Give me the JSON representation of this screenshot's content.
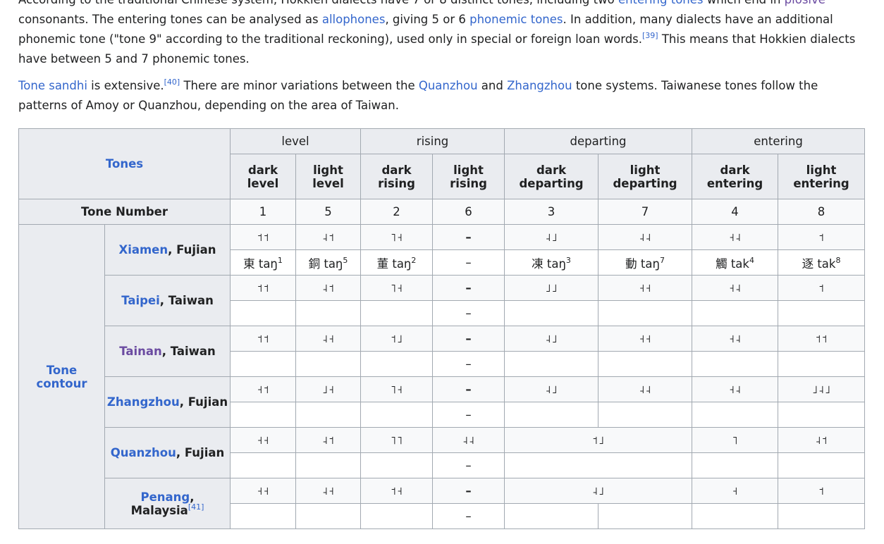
{
  "paragraph1": {
    "line0_pre": "According to the traditional Chinese system, Hokkien dialects have 7 or 8 distinct tones, including two ",
    "link_entering_tones": "entering tones",
    "line0_mid": " which end in ",
    "link_plosive": "plosive",
    "line0_post": " consonants. The entering tones can be analysed as ",
    "link_allophones": "allophones",
    "mid_text": ", giving 5 or 6 ",
    "link_phonemic_tones": "phonemic tones",
    "post_text": ". In addition, many dialects have an additional phonemic tone (\"tone 9\" according to the traditional reckoning), used only in special or foreign loan words.",
    "ref": "[39]",
    "tail_text": " This means that Hokkien dialects have between 5 and 7 phonemic tones."
  },
  "paragraph2": {
    "link_tone_sandhi": "Tone sandhi",
    "text1": " is extensive.",
    "ref": "[40]",
    "text2": " There are minor variations between the ",
    "link_quanzhou": "Quanzhou",
    "text3": " and ",
    "link_zhangzhou": "Zhangzhou",
    "text4": " tone systems. Taiwanese tones follow the patterns of Amoy or Quanzhou, depending on the area of Taiwan."
  },
  "table": {
    "corner_link": "Tones",
    "groups": [
      "level",
      "rising",
      "departing",
      "entering"
    ],
    "subheaders": [
      [
        "dark",
        "level"
      ],
      [
        "light",
        "level"
      ],
      [
        "dark",
        "rising"
      ],
      [
        "light",
        "rising"
      ],
      [
        "dark",
        "departing"
      ],
      [
        "light",
        "departing"
      ],
      [
        "dark",
        "entering"
      ],
      [
        "light",
        "entering"
      ]
    ],
    "tone_number_label": "Tone Number",
    "tone_numbers": [
      "1",
      "5",
      "2",
      "6",
      "3",
      "7",
      "4",
      "8"
    ],
    "contour_label_line1": "Tone",
    "contour_label_line2": "contour",
    "dash": "–",
    "rows": {
      "xiamen": {
        "place": "Xiamen",
        "region": ", Fujian",
        "contours": [
          "˦˦",
          "˨˦",
          "˥˧",
          "–",
          "˨˩",
          "˨˨",
          "˧˨",
          "˦"
        ],
        "examples": [
          {
            "char": "東 taŋ",
            "sup": "1"
          },
          {
            "char": "銅 taŋ",
            "sup": "5"
          },
          {
            "char": "董 taŋ",
            "sup": "2"
          },
          {
            "char": "–",
            "sup": ""
          },
          {
            "char": "凍 taŋ",
            "sup": "3"
          },
          {
            "char": "動 taŋ",
            "sup": "7"
          },
          {
            "char": "觸 tak",
            "sup": "4"
          },
          {
            "char": "逐 tak",
            "sup": "8"
          }
        ]
      },
      "taipei": {
        "place": "Taipei",
        "region": ", Taiwan",
        "contours": [
          "˦˦",
          "˨˦",
          "˥˧",
          "–",
          "˩˩",
          "˧˧",
          "˧˨",
          "˦"
        ],
        "dash": "–"
      },
      "tainan": {
        "place": "Tainan",
        "region": ", Taiwan",
        "contours": [
          "˦˦",
          "˨˧",
          "˦˩",
          "–",
          "˨˩",
          "˧˧",
          "˧˨",
          "˦˦"
        ],
        "dash": "–"
      },
      "zhangzhou": {
        "place": "Zhangzhou",
        "region": ", Fujian",
        "contours": [
          "˧˦",
          "˩˧",
          "˥˧",
          "–",
          "˨˩",
          "˨˨",
          "˧˨",
          "˩˨˩"
        ],
        "dash": "–"
      },
      "quanzhou": {
        "place": "Quanzhou",
        "region": ", Fujian",
        "contours": [
          "˧˧",
          "˨˦",
          "˥˥",
          "˨˨",
          "˦˩",
          "˥",
          "˨˦"
        ],
        "dash": "–"
      },
      "penang": {
        "place": "Penang",
        "region": ",",
        "region2": "Malaysia",
        "ref": "[41]",
        "contours": [
          "˧˧",
          "˨˧",
          "˦˧",
          "–",
          "˨˩",
          "˧",
          "˦"
        ],
        "dash": "–"
      }
    }
  }
}
